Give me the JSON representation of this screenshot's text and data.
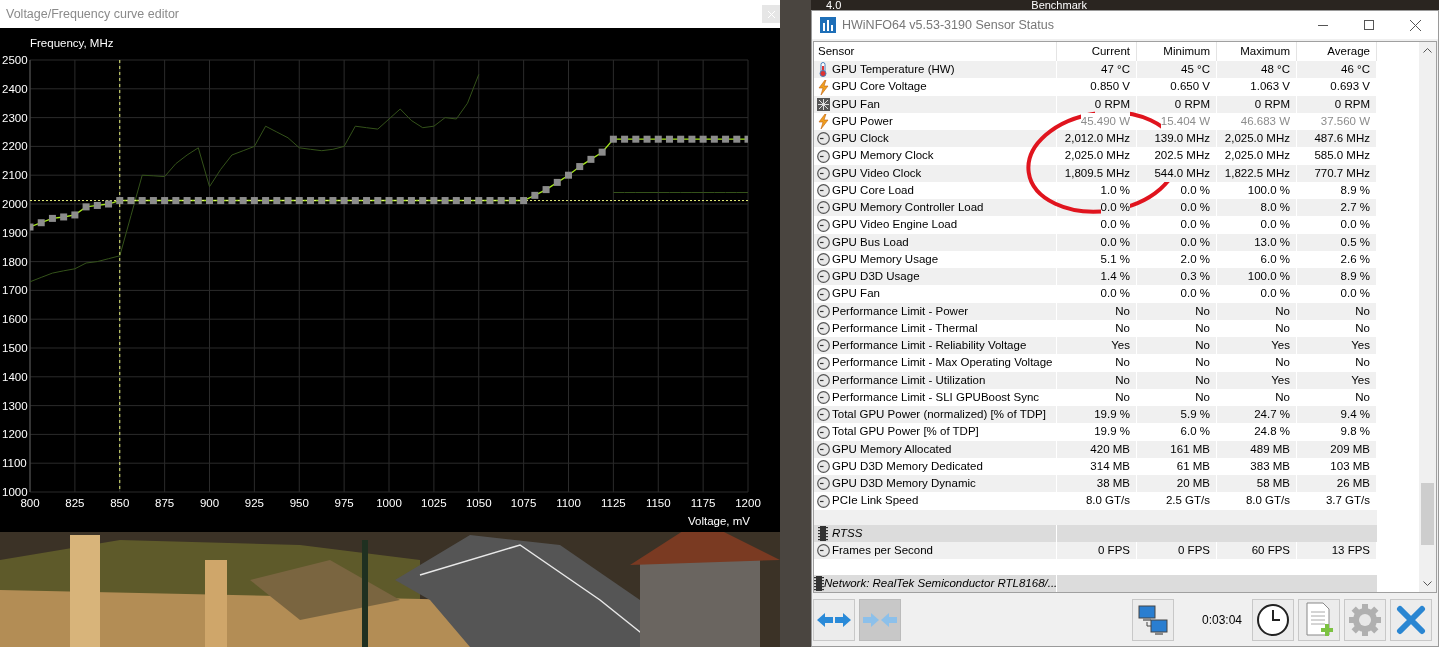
{
  "editor": {
    "title": "Voltage/Frequency curve editor",
    "chart_data": {
      "type": "line",
      "ylabel": "Frequency, MHz",
      "xlabel": "Voltage, mV",
      "x": [
        800,
        806.25,
        812.5,
        818.75,
        825,
        831.25,
        837.5,
        843.75,
        850,
        856.25,
        862.5,
        868.75,
        875,
        881.25,
        887.5,
        893.75,
        900,
        906.25,
        912.5,
        918.75,
        925,
        931.25,
        937.5,
        943.75,
        950,
        956.25,
        962.5,
        968.75,
        975,
        981.25,
        987.5,
        993.75,
        1000,
        1006.25,
        1012.5,
        1018.75,
        1025,
        1031.25,
        1037.5,
        1043.75,
        1050,
        1056.25,
        1062.5,
        1068.75,
        1075,
        1081.25,
        1087.5,
        1093.75,
        1100,
        1106.25,
        1112.5,
        1118.75,
        1125,
        1131.25,
        1137.5,
        1143.75,
        1150,
        1156.25,
        1162.5,
        1168.75,
        1175,
        1181.25,
        1187.5,
        1193.75,
        1200
      ],
      "series": [
        {
          "color": "#a4e61e",
          "marker": "square",
          "values": [
            1920,
            1935,
            1950,
            1955,
            1962,
            1990,
            1995,
            2000,
            2012,
            2012,
            2012,
            2012,
            2012,
            2012,
            2012,
            2012,
            2012,
            2012,
            2012,
            2012,
            2012,
            2012,
            2012,
            2012,
            2012,
            2012,
            2012,
            2012,
            2012,
            2012,
            2012,
            2012,
            2012,
            2012,
            2012,
            2012,
            2012,
            2012,
            2012,
            2012,
            2012,
            2012,
            2012,
            2012,
            2012,
            2030,
            2050,
            2075,
            2100,
            2130,
            2155,
            2180,
            2225,
            2225,
            2225,
            2225,
            2225,
            2225,
            2225,
            2225,
            2225,
            2225,
            2225,
            2225,
            2225
          ]
        },
        {
          "color": "#34521a",
          "marker": "none",
          "values": [
            1730,
            1745,
            1760,
            1768,
            1775,
            1795,
            1800,
            1810,
            1820,
            1960,
            2100,
            2098,
            2095,
            2140,
            2170,
            2195,
            2060,
            2120,
            2170,
            2185,
            2200,
            2270,
            2250,
            2230,
            2195,
            2190,
            2185,
            2190,
            2200,
            2270,
            2265,
            2260,
            2295,
            2330,
            2290,
            2265,
            2270,
            2300,
            2295,
            2350,
            2450,
            null,
            null,
            null,
            null,
            null,
            null,
            null,
            null,
            null,
            null,
            null,
            2040,
            2040,
            2040,
            2040,
            2040,
            2040,
            2040,
            2040,
            2040,
            2040,
            2040,
            2040,
            2040
          ]
        }
      ],
      "xlim": [
        800,
        1200
      ],
      "ylim": [
        1000,
        2500
      ],
      "xticks": [
        800,
        825,
        850,
        875,
        900,
        925,
        950,
        975,
        1000,
        1025,
        1050,
        1075,
        1100,
        1125,
        1150,
        1175,
        1200
      ],
      "yticks": [
        1000,
        1100,
        1200,
        1300,
        1400,
        1500,
        1600,
        1700,
        1800,
        1900,
        2000,
        2100,
        2200,
        2300,
        2400,
        2500
      ],
      "grid": true,
      "ref_lines": [
        {
          "axis": "x",
          "value": 850
        },
        {
          "axis": "y",
          "value": 2012
        }
      ]
    }
  },
  "backdrop_labels": [
    "4.0",
    "Benchmark"
  ],
  "hwinfo": {
    "title": "HWiNFO64 v5.53-3190 Sensor Status",
    "columns": [
      "Sensor",
      "Current",
      "Minimum",
      "Maximum",
      "Average"
    ],
    "rows": [
      {
        "kind": "temperature",
        "sensor": "GPU Temperature (HW)",
        "values": [
          "47 °C",
          "45 °C",
          "48 °C",
          "46 °C"
        ],
        "dimmed": false
      },
      {
        "kind": "voltage",
        "sensor": "GPU Core Voltage",
        "values": [
          "0.850 V",
          "0.650 V",
          "1.063 V",
          "0.693 V"
        ],
        "dimmed": false
      },
      {
        "kind": "fan",
        "sensor": "GPU Fan",
        "values": [
          "0 RPM",
          "0 RPM",
          "0 RPM",
          "0 RPM"
        ],
        "dimmed": false
      },
      {
        "kind": "voltage",
        "sensor": "GPU Power",
        "values": [
          "45.490 W",
          "15.404 W",
          "46.683 W",
          "37.560 W"
        ],
        "dimmed": true
      },
      {
        "kind": "gauge",
        "sensor": "GPU Clock",
        "values": [
          "2,012.0 MHz",
          "139.0 MHz",
          "2,025.0 MHz",
          "487.6 MHz"
        ],
        "dimmed": false
      },
      {
        "kind": "gauge",
        "sensor": "GPU Memory Clock",
        "values": [
          "2,025.0 MHz",
          "202.5 MHz",
          "2,025.0 MHz",
          "585.0 MHz"
        ],
        "dimmed": false
      },
      {
        "kind": "gauge",
        "sensor": "GPU Video Clock",
        "values": [
          "1,809.5 MHz",
          "544.0 MHz",
          "1,822.5 MHz",
          "770.7 MHz"
        ],
        "dimmed": false
      },
      {
        "kind": "gauge",
        "sensor": "GPU Core Load",
        "values": [
          "1.0 %",
          "0.0 %",
          "100.0 %",
          "8.9 %"
        ],
        "dimmed": false
      },
      {
        "kind": "gauge",
        "sensor": "GPU Memory Controller Load",
        "values": [
          "0.0 %",
          "0.0 %",
          "8.0 %",
          "2.7 %"
        ],
        "dimmed": false
      },
      {
        "kind": "gauge",
        "sensor": "GPU Video Engine Load",
        "values": [
          "0.0 %",
          "0.0 %",
          "0.0 %",
          "0.0 %"
        ],
        "dimmed": false
      },
      {
        "kind": "gauge",
        "sensor": "GPU Bus Load",
        "values": [
          "0.0 %",
          "0.0 %",
          "13.0 %",
          "0.5 %"
        ],
        "dimmed": false
      },
      {
        "kind": "gauge",
        "sensor": "GPU Memory Usage",
        "values": [
          "5.1 %",
          "2.0 %",
          "6.0 %",
          "2.6 %"
        ],
        "dimmed": false
      },
      {
        "kind": "gauge",
        "sensor": "GPU D3D Usage",
        "values": [
          "1.4 %",
          "0.3 %",
          "100.0 %",
          "8.9 %"
        ],
        "dimmed": false
      },
      {
        "kind": "gauge",
        "sensor": "GPU Fan",
        "values": [
          "0.0 %",
          "0.0 %",
          "0.0 %",
          "0.0 %"
        ],
        "dimmed": false
      },
      {
        "kind": "gauge",
        "sensor": "Performance Limit - Power",
        "values": [
          "No",
          "No",
          "No",
          "No"
        ],
        "dimmed": false
      },
      {
        "kind": "gauge",
        "sensor": "Performance Limit - Thermal",
        "values": [
          "No",
          "No",
          "No",
          "No"
        ],
        "dimmed": false
      },
      {
        "kind": "gauge",
        "sensor": "Performance Limit - Reliability Voltage",
        "values": [
          "Yes",
          "No",
          "Yes",
          "Yes"
        ],
        "dimmed": false
      },
      {
        "kind": "gauge",
        "sensor": "Performance Limit - Max Operating Voltage",
        "values": [
          "No",
          "No",
          "No",
          "No"
        ],
        "dimmed": false
      },
      {
        "kind": "gauge",
        "sensor": "Performance Limit - Utilization",
        "values": [
          "No",
          "No",
          "Yes",
          "Yes"
        ],
        "dimmed": false
      },
      {
        "kind": "gauge",
        "sensor": "Performance Limit - SLI GPUBoost Sync",
        "values": [
          "No",
          "No",
          "No",
          "No"
        ],
        "dimmed": false
      },
      {
        "kind": "gauge",
        "sensor": "Total GPU Power (normalized) [% of TDP]",
        "values": [
          "19.9 %",
          "5.9 %",
          "24.7 %",
          "9.4 %"
        ],
        "dimmed": false
      },
      {
        "kind": "gauge",
        "sensor": "Total GPU Power [% of TDP]",
        "values": [
          "19.9 %",
          "6.0 %",
          "24.8 %",
          "9.8 %"
        ],
        "dimmed": false
      },
      {
        "kind": "gauge",
        "sensor": "GPU Memory Allocated",
        "values": [
          "420 MB",
          "161 MB",
          "489 MB",
          "209 MB"
        ],
        "dimmed": false
      },
      {
        "kind": "gauge",
        "sensor": "GPU D3D Memory Dedicated",
        "values": [
          "314 MB",
          "61 MB",
          "383 MB",
          "103 MB"
        ],
        "dimmed": false
      },
      {
        "kind": "gauge",
        "sensor": "GPU D3D Memory Dynamic",
        "values": [
          "38 MB",
          "20 MB",
          "58 MB",
          "26 MB"
        ],
        "dimmed": false
      },
      {
        "kind": "gauge",
        "sensor": "PCIe Link Speed",
        "values": [
          "8.0 GT/s",
          "2.5 GT/s",
          "8.0 GT/s",
          "3.7 GT/s"
        ],
        "dimmed": false
      },
      {
        "kind": "blank"
      },
      {
        "kind": "group",
        "sensor": "RTSS"
      },
      {
        "kind": "gauge",
        "sensor": "Frames per Second",
        "values": [
          "0 FPS",
          "0 FPS",
          "60 FPS",
          "13 FPS"
        ],
        "dimmed": false
      },
      {
        "kind": "blank"
      },
      {
        "kind": "group",
        "sensor": "Network: RealTek Semiconductor RTL8168/..."
      }
    ],
    "toolbar": {
      "buttons_left": [
        {
          "kind": "expand",
          "pressed": false
        },
        {
          "kind": "collapse",
          "pressed": true
        }
      ],
      "buttons_mid": [
        {
          "kind": "network",
          "pressed": false
        }
      ],
      "timer": "0:03:04",
      "buttons_right": [
        {
          "kind": "clock",
          "pressed": false
        },
        {
          "kind": "report",
          "pressed": false
        },
        {
          "kind": "settings",
          "pressed": false
        },
        {
          "kind": "close",
          "pressed": false
        }
      ]
    }
  }
}
